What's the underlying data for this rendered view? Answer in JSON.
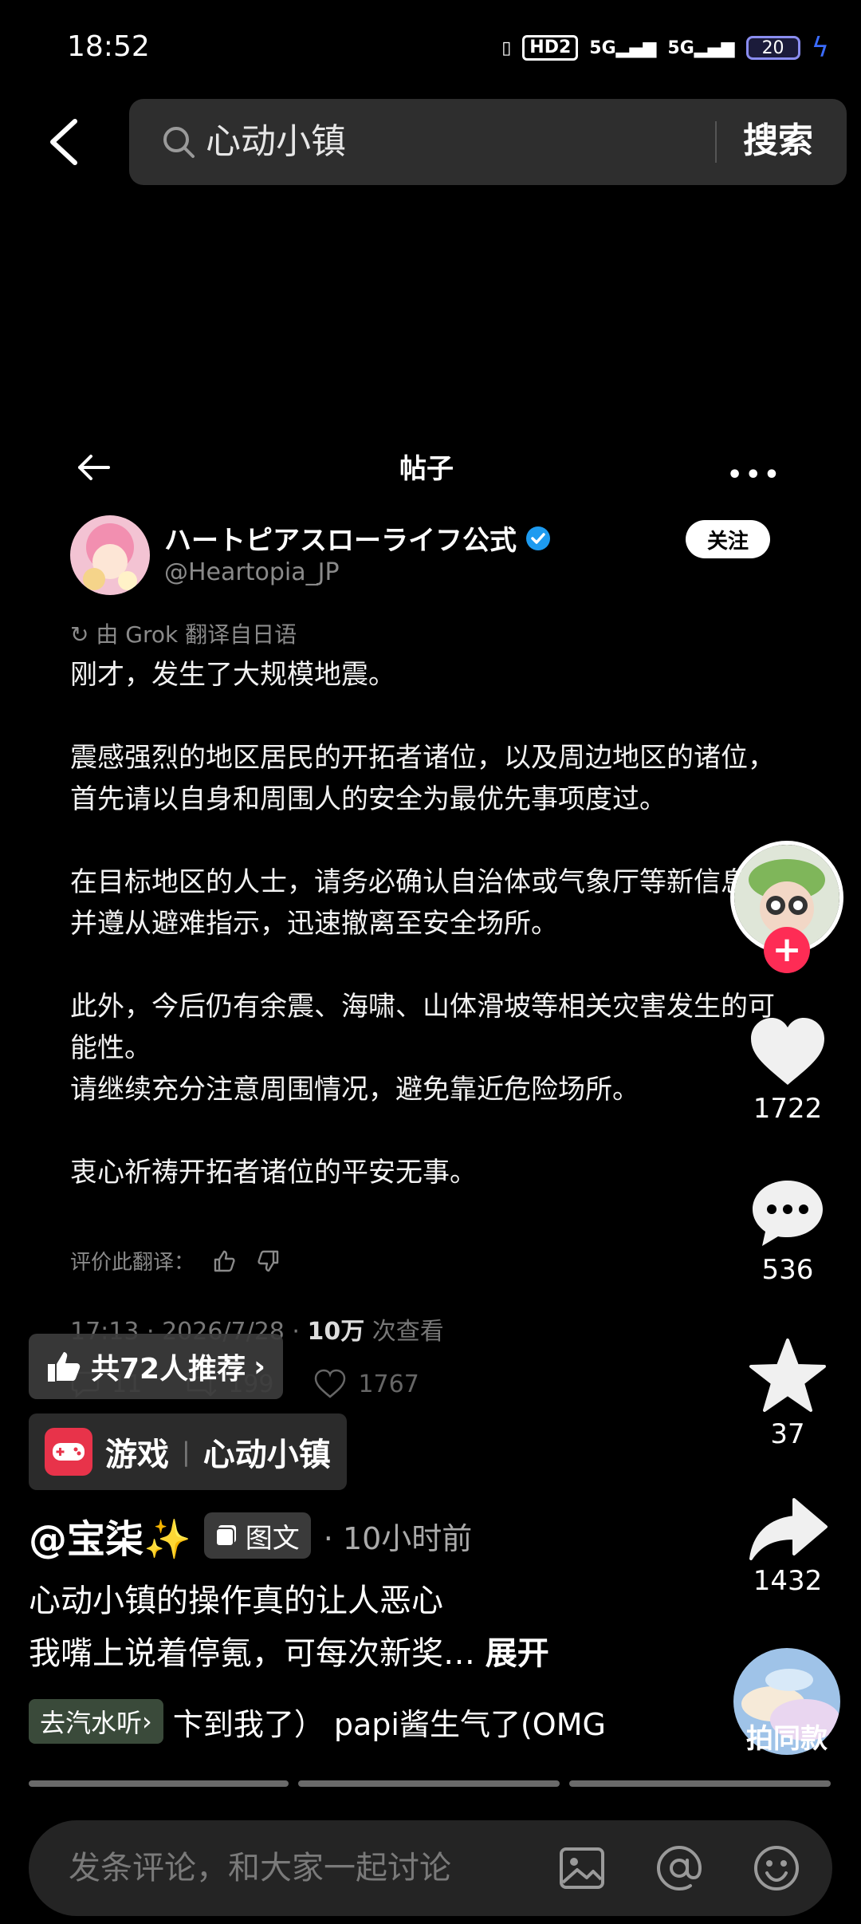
{
  "status_bar": {
    "time": "18:52",
    "hd_label": "HD2",
    "signal1": "5G",
    "signal2": "5G",
    "battery": "20"
  },
  "search": {
    "query": "心动小镇",
    "button": "搜索"
  },
  "post": {
    "header_title": "帖子",
    "account_name": "ハートピアスローライフ公式",
    "account_handle": "@Heartopia_JP",
    "follow_label": "关注",
    "translate_note": "由 Grok 翻译自日语",
    "body": "刚才，发生了大规模地震。\n\n震感强烈的地区居民的开拓者诸位，以及周边地区的诸位，首先请以自身和周围人的安全为最优先事项度过。\n\n在目标地区的人士，请务必确认自治体或气象厅等新信息，并遵从避难指示，迅速撤离至安全场所。\n\n此外，今后仍有余震、海啸、山体滑坡等相关灾害发生的可能性。\n请继续充分注意周围情况，避免靠近危险场所。\n\n衷心祈祷开拓者诸位的平安无事。",
    "rate_label": "评价此翻译：",
    "meta_time": "17:13 · 2026/7/28 · ",
    "meta_views": "10万",
    "meta_views_suffix": " 次查看",
    "replies": "11",
    "reposts": "199",
    "likes": "1767"
  },
  "overlay": {
    "recommend": "共72人推荐",
    "game_category": "游戏",
    "game_name": "心动小镇",
    "author": "@宝柒✨",
    "type_badge": "图文",
    "time_ago": "· 10小时前",
    "caption_line1": "心动小镇的操作真的让人恶心",
    "caption_line2": "我嘴上说着停氪，可每次新奖…",
    "expand": "展开",
    "music_tag": "去汽水听",
    "music_title": "卞到我了）  papi酱生气了(OMG"
  },
  "actions": {
    "likes": "1722",
    "comments": "536",
    "favorites": "37",
    "shares": "1432",
    "same_style": "拍同款"
  },
  "comment_bar": {
    "placeholder": "发条评论，和大家一起讨论"
  },
  "colors": {
    "background": "#000000",
    "accent_red": "#fe2c55",
    "verified_blue": "#1d9bf0"
  }
}
